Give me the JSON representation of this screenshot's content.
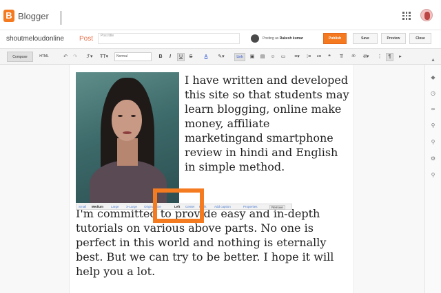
{
  "header": {
    "app_title": "Blogger",
    "brand_color": "#f4791f",
    "logo_letter": "B",
    "icons": [
      "apps-icon",
      "account-avatar-icon"
    ]
  },
  "post_bar": {
    "blog_name": "shoutmeloudonline",
    "section_label": "Post",
    "title_placeholder": "Post title",
    "posting_as_prefix": "Posting as",
    "author_name": "Rakesh kumar",
    "publish_label": "Publish",
    "save_label": "Save",
    "preview_label": "Preview",
    "close_label": "Close"
  },
  "toolbar": {
    "compose_label": "Compose",
    "html_label": "HTML",
    "font_value": "Normal",
    "bold_glyph": "B",
    "italic_glyph": "I",
    "underline_glyph": "U",
    "strike_glyph": "S",
    "font_color_glyph": "A",
    "link_label": "Link"
  },
  "image_bar": {
    "options": [
      "Small",
      "Medium",
      "Large",
      "X-Large",
      "Original size",
      "Left",
      "Center",
      "Right",
      "Add caption",
      "Properties"
    ],
    "selected_size": "Medium",
    "selected_align": "Left",
    "remove_label": "Remove"
  },
  "content": {
    "paragraph_1": "I have written and developed this site so that students may learn blogging, online make money, affiliate marketingand smartphone review in hindi and English in simple method.",
    "paragraph_2": "I'm committed to provide easy and in-depth tutorials on various above parts. No one is perfect in this world and nothing is eternally best. But we can try to be better. I hope it will help you a lot."
  },
  "highlight_color": "#f47b20"
}
